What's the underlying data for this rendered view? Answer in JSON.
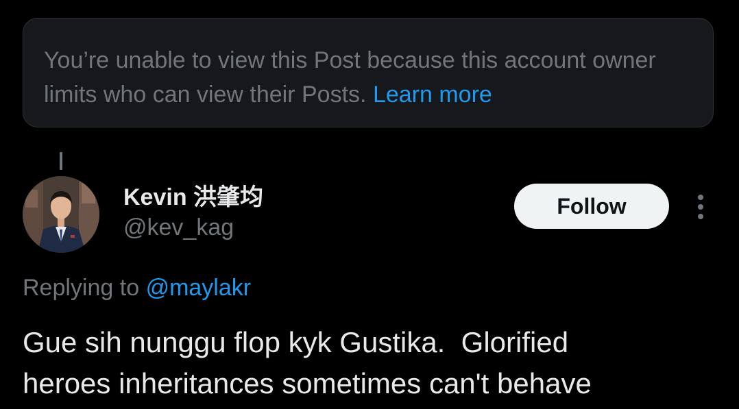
{
  "notice": {
    "text": "You’re unable to view this Post because this account owner limits who can view their Posts.",
    "link_label": "Learn more"
  },
  "post": {
    "author": {
      "display_name": "Kevin 洪肇均",
      "handle": "@kev_kag",
      "avatar_icon": "profile-photo"
    },
    "follow_label": "Follow",
    "more_icon": "more-options-icon",
    "replying_prefix": "Replying to",
    "replying_to": "@maylakr",
    "text_line1": "Gue sih nunggu flop kyk Gustika.  Glorified",
    "text_line2": "heroes inheritances sometimes can't behave"
  },
  "colors": {
    "background": "#000000",
    "notice_bg": "#16181c",
    "muted_text": "#71767b",
    "primary_text": "#e7e9ea",
    "link": "#1d9bf0",
    "follow_bg": "#eff3f4"
  }
}
